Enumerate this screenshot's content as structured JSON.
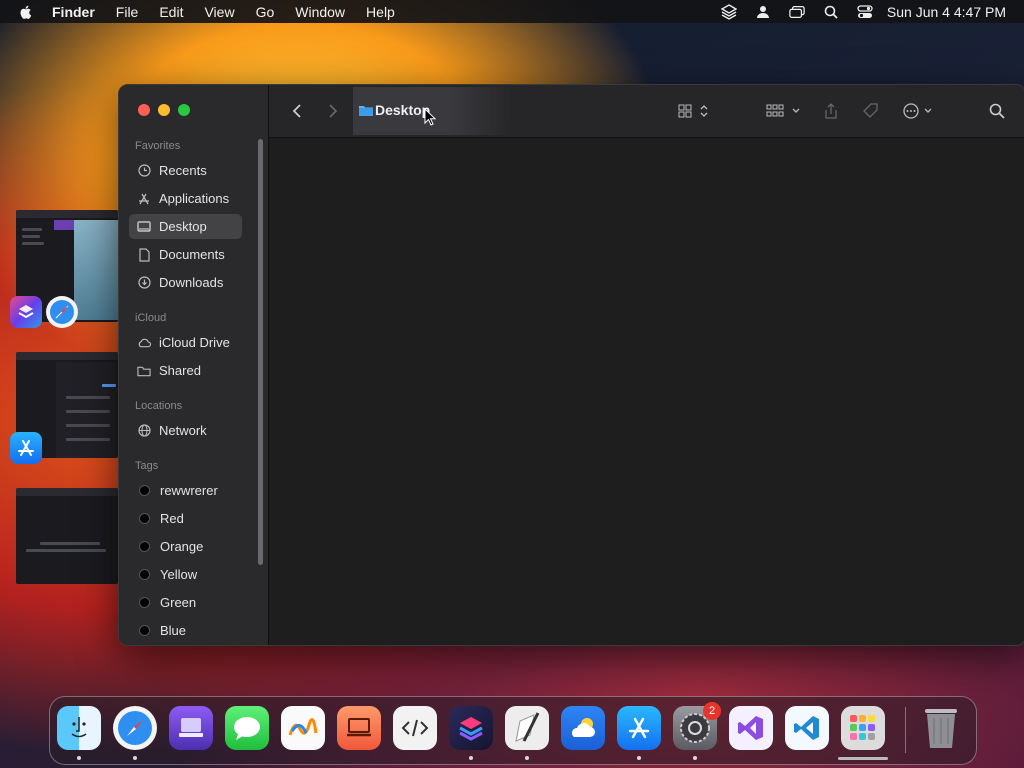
{
  "menubar": {
    "apple_icon": "apple-icon",
    "items": [
      "Finder",
      "File",
      "Edit",
      "View",
      "Go",
      "Window",
      "Help"
    ],
    "status_icons": [
      "stack-icon",
      "user-icon",
      "screen-mirror-icon",
      "search-icon",
      "control-center-icon"
    ],
    "clock": "Sun Jun 4  4:47 PM"
  },
  "window": {
    "title": "Desktop",
    "sidebar": {
      "favorites_title": "Favorites",
      "favorites": [
        "Recents",
        "Applications",
        "Desktop",
        "Documents",
        "Downloads"
      ],
      "icloud_title": "iCloud",
      "icloud": [
        "iCloud Drive",
        "Shared"
      ],
      "locations_title": "Locations",
      "locations": [
        "Network"
      ],
      "tags_title": "Tags",
      "tags": [
        "rewwrerer",
        "Red",
        "Orange",
        "Yellow",
        "Green",
        "Blue"
      ]
    }
  },
  "dock": {
    "apps": [
      "Finder",
      "Safari",
      "Mirror",
      "Messages",
      "Freeform",
      "Presenter",
      "Script Editor",
      "Shortcuts",
      "Notes Pen",
      "Weather",
      "App Store",
      "System Settings",
      "Visual Studio",
      "VS Code",
      "Launchpad",
      "Trash"
    ],
    "settings_badge": "2"
  },
  "colors": {
    "window_bg": "#1e1e1e",
    "sidebar_bg": "#2a2a2c",
    "selected": "#434346",
    "close": "#ff5f57",
    "minimize": "#febc2e",
    "zoom": "#28c840"
  }
}
